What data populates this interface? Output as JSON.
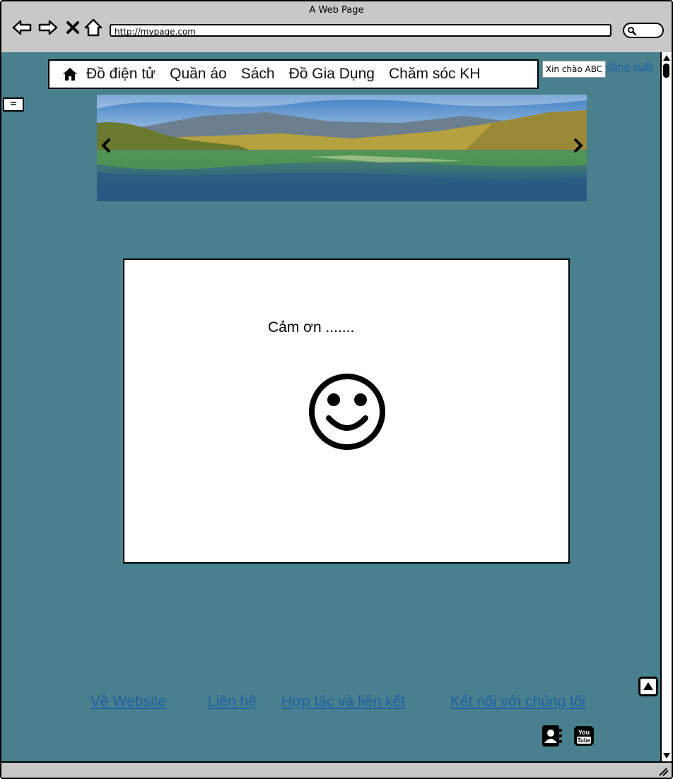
{
  "browser": {
    "title": "A Web Page",
    "url": "http://mypage.com"
  },
  "menu": {
    "items": [
      "Đồ điện tử",
      "Quần áo",
      "Sách",
      "Đồ Gia Dụng",
      "Chăm sóc KH"
    ]
  },
  "user": {
    "greeting": "Xin chào ABC",
    "logout": "đăng xuất"
  },
  "sidebar": {
    "toggle_label": "="
  },
  "main": {
    "thank_you": "Cảm ơn ......."
  },
  "footer": {
    "links": [
      "Về Website",
      "Liên hệ",
      "Hợp tác và liên kết",
      "Kết nối với chúng tôi"
    ]
  },
  "colors": {
    "background": "#48808d",
    "link": "#1f5fa8"
  },
  "icons": [
    "back-arrow-icon",
    "forward-arrow-icon",
    "close-icon",
    "home-icon",
    "search-icon",
    "chevron-left-icon",
    "chevron-right-icon",
    "smiley-icon",
    "scroll-top-icon",
    "address-book-icon",
    "youtube-icon"
  ]
}
